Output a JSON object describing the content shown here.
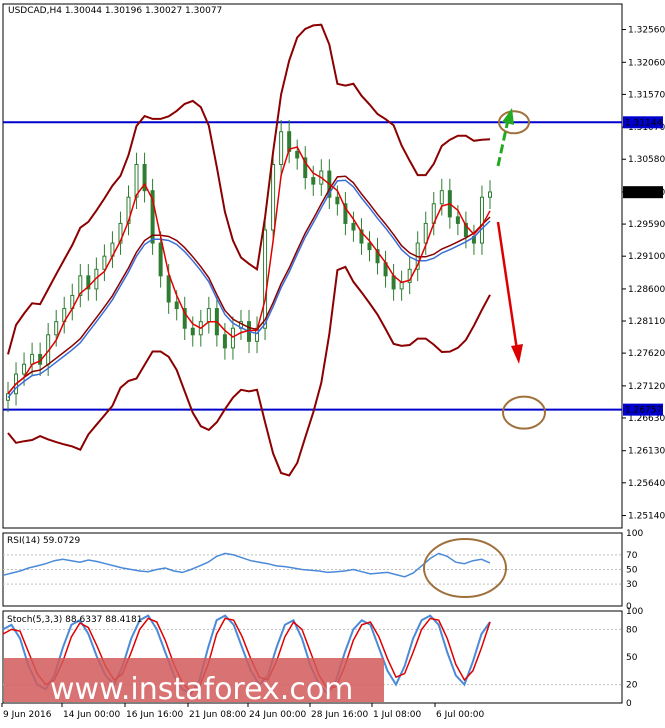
{
  "main_title": "USDCAD,H4  1.30044 1.30196 1.30027 1.30077",
  "rsi_title": "RSI(14) 59.0729",
  "stoch_title": "Stoch(5,3,3) 88.6337 88.4181",
  "watermark": "www.instaforex.com",
  "colors": {
    "candle": "#2e7d32",
    "bollinger": "#8b0000",
    "ma_fast": "#e00000",
    "ma_slow": "#3a6ed8",
    "level": "#0000cc",
    "rsi": "#4a8ad8",
    "stoch_main": "#4a8ad8",
    "stoch_signal": "#e00000",
    "circle": "#a0703c",
    "arrow_up": "#22aa22",
    "arrow_down": "#dd0000",
    "watermark_bg": "#d25a5a"
  },
  "chart_data": [
    {
      "type": "candlestick",
      "symbol": "USDCAD",
      "timeframe": "H4",
      "ohlc_last": {
        "open": 1.30044,
        "high": 1.30196,
        "low": 1.30027,
        "close": 1.30077
      },
      "ylim": [
        1.2495,
        1.3295
      ],
      "y_ticks": [
        "1.32560",
        "1.32060",
        "1.31570",
        "1.31070",
        "1.30580",
        "1.30080",
        "1.29590",
        "1.29100",
        "1.28600",
        "1.28110",
        "1.27620",
        "1.27120",
        "1.26630",
        "1.26130",
        "1.25640",
        "1.25140"
      ],
      "x_ticks": [
        "9 Jun 2016",
        "14 Jun 00:00",
        "16 Jun 16:00",
        "21 Jun 08:00",
        "24 Jun 00:00",
        "28 Jun 16:00",
        "1 Jul 08:00",
        "6 Jul 00:00"
      ],
      "levels": [
        {
          "value": 1.31144,
          "label": "1.31144"
        },
        {
          "value": 1.26757,
          "label": "1.26757"
        }
      ],
      "current_price_label": "1.30077",
      "close_series": [
        1.27,
        1.273,
        1.2745,
        1.276,
        1.2745,
        1.279,
        1.281,
        1.283,
        1.285,
        1.288,
        1.286,
        1.289,
        1.291,
        1.293,
        1.296,
        1.3,
        1.305,
        1.301,
        1.293,
        1.288,
        1.284,
        1.283,
        1.28,
        1.279,
        1.281,
        1.283,
        1.279,
        1.277,
        1.28,
        1.281,
        1.278,
        1.28,
        1.295,
        1.305,
        1.31,
        1.307,
        1.306,
        1.303,
        1.302,
        1.304,
        1.3,
        1.299,
        1.296,
        1.295,
        1.293,
        1.292,
        1.29,
        1.288,
        1.286,
        1.287,
        1.289,
        1.293,
        1.296,
        1.299,
        1.301,
        1.297,
        1.296,
        1.294,
        1.293,
        1.3,
        1.3008
      ]
    },
    {
      "type": "line",
      "name": "RSI(14)",
      "ylim": [
        0,
        100
      ],
      "y_ticks": [
        "100",
        "70",
        "50",
        "30",
        "0"
      ],
      "values": [
        42,
        45,
        48,
        52,
        55,
        58,
        62,
        64,
        62,
        60,
        63,
        61,
        58,
        55,
        52,
        50,
        48,
        47,
        50,
        52,
        48,
        46,
        50,
        55,
        60,
        68,
        72,
        70,
        66,
        62,
        60,
        58,
        55,
        54,
        52,
        50,
        49,
        48,
        46,
        47,
        48,
        50,
        47,
        44,
        45,
        46,
        43,
        40,
        45,
        55,
        65,
        72,
        68,
        60,
        58,
        62,
        64,
        59
      ]
    },
    {
      "type": "line",
      "name": "Stoch(5,3,3)",
      "ylim": [
        0,
        100
      ],
      "y_ticks": [
        "100",
        "80",
        "50",
        "20",
        "0"
      ],
      "main_values": [
        80,
        85,
        70,
        40,
        20,
        15,
        30,
        60,
        85,
        90,
        75,
        50,
        30,
        20,
        40,
        70,
        90,
        95,
        80,
        55,
        30,
        15,
        10,
        25,
        60,
        90,
        95,
        85,
        60,
        35,
        20,
        30,
        60,
        85,
        90,
        70,
        40,
        20,
        10,
        25,
        55,
        80,
        90,
        85,
        60,
        35,
        20,
        40,
        70,
        90,
        95,
        85,
        55,
        30,
        20,
        45,
        75,
        88
      ],
      "signal_values": [
        75,
        80,
        78,
        55,
        32,
        20,
        25,
        45,
        72,
        87,
        82,
        62,
        40,
        25,
        32,
        55,
        80,
        92,
        88,
        68,
        42,
        22,
        12,
        18,
        42,
        75,
        92,
        90,
        72,
        48,
        28,
        25,
        45,
        72,
        88,
        80,
        55,
        30,
        15,
        18,
        40,
        68,
        85,
        88,
        72,
        48,
        28,
        32,
        55,
        80,
        92,
        90,
        70,
        42,
        25,
        35,
        60,
        88
      ]
    }
  ]
}
